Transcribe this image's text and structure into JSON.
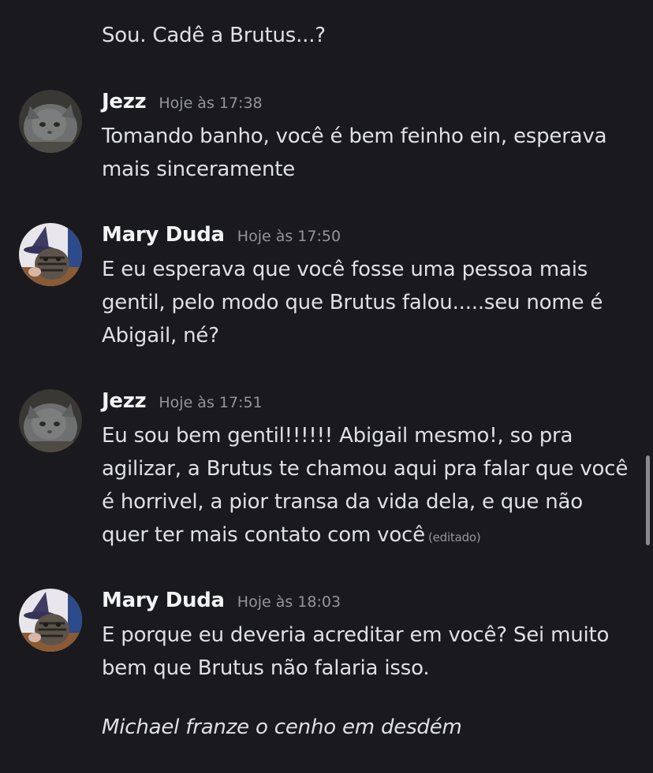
{
  "continuation_text": "Sou. Cadê a Brutus...?",
  "messages": [
    {
      "author": "Jezz",
      "timestamp": "Hoje às 17:38",
      "avatar": "gray-cat-avatar",
      "text": "Tomando banho, você é bem feinho ein, esperava mais sinceramente",
      "edited": ""
    },
    {
      "author": "Mary Duda",
      "timestamp": "Hoje às 17:50",
      "avatar": "tabby-kitten-witch-hat-avatar",
      "text": "E eu esperava que você fosse uma pessoa mais gentil, pelo modo que Brutus falou.....seu nome é Abigail, né?",
      "edited": ""
    },
    {
      "author": "Jezz",
      "timestamp": "Hoje às 17:51",
      "avatar": "gray-cat-avatar",
      "text": "Eu sou bem gentil!!!!!! Abigail mesmo!, so pra agilizar, a Brutus te chamou aqui pra falar que você é horrivel, a pior transa da vida dela, e que não quer ter mais contato com você",
      "edited": "(editado)"
    },
    {
      "author": "Mary Duda",
      "timestamp": "Hoje às 18:03",
      "avatar": "tabby-kitten-witch-hat-avatar",
      "text": "E porque eu deveria acreditar em você? Sei muito bem que Brutus não falaria isso.",
      "edited": ""
    }
  ],
  "italic_text": "Michael franze o cenho em desdém",
  "colors": {
    "background": "#1a1a1e",
    "text": "#dfe0e4",
    "username": "#f2f3f5",
    "timestamp": "#94959c"
  }
}
